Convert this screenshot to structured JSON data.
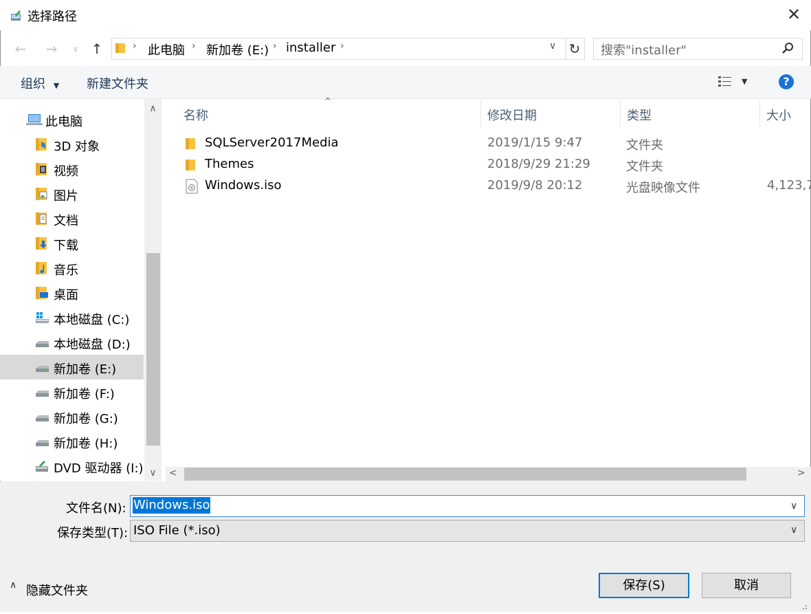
{
  "window": {
    "title": "选择路径"
  },
  "nav": {
    "breadcrumb": [
      "此电脑",
      "新加卷 (E:)",
      "installer"
    ],
    "search_placeholder": "搜索\"installer\""
  },
  "toolbar": {
    "organize": "组织",
    "new_folder": "新建文件夹"
  },
  "sidebar": {
    "items": [
      {
        "label": "此电脑",
        "icon": "computer-icon"
      },
      {
        "label": "3D 对象",
        "icon": "folder-3d-icon"
      },
      {
        "label": "视频",
        "icon": "folder-video-icon"
      },
      {
        "label": "图片",
        "icon": "folder-pictures-icon"
      },
      {
        "label": "文档",
        "icon": "folder-documents-icon"
      },
      {
        "label": "下载",
        "icon": "folder-downloads-icon"
      },
      {
        "label": "音乐",
        "icon": "folder-music-icon"
      },
      {
        "label": "桌面",
        "icon": "folder-desktop-icon"
      },
      {
        "label": "本地磁盘 (C:)",
        "icon": "system-drive-icon"
      },
      {
        "label": "本地磁盘 (D:)",
        "icon": "drive-icon"
      },
      {
        "label": "新加卷 (E:)",
        "icon": "drive-icon",
        "selected": true
      },
      {
        "label": "新加卷 (F:)",
        "icon": "drive-icon"
      },
      {
        "label": "新加卷 (G:)",
        "icon": "drive-icon"
      },
      {
        "label": "新加卷 (H:)",
        "icon": "drive-icon"
      },
      {
        "label": "DVD 驱动器 (I:)",
        "icon": "dvd-drive-icon"
      }
    ]
  },
  "columns": {
    "name": "名称",
    "modified": "修改日期",
    "type": "类型",
    "size": "大小"
  },
  "files": [
    {
      "name": "SQLServer2017Media",
      "modified": "2019/1/15 9:47",
      "type": "文件夹",
      "size": "",
      "icon": "folder-icon"
    },
    {
      "name": "Themes",
      "modified": "2018/9/29 21:29",
      "type": "文件夹",
      "size": "",
      "icon": "folder-icon"
    },
    {
      "name": "Windows.iso",
      "modified": "2019/9/8 20:12",
      "type": "光盘映像文件",
      "size": "4,123,7",
      "icon": "disc-image-icon"
    }
  ],
  "form": {
    "filename_label": "文件名(N):",
    "filename_value": "Windows.iso",
    "savetype_label": "保存类型(T):",
    "savetype_value": "ISO File (*.iso)"
  },
  "footer": {
    "hide_folders": "隐藏文件夹",
    "save": "保存(S)",
    "cancel": "取消"
  },
  "colors": {
    "accent": "#0078d7",
    "selection": "#d9d9d9",
    "panel": "#f0f0f0"
  }
}
